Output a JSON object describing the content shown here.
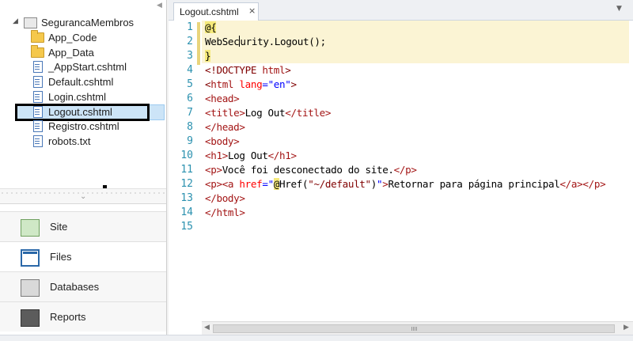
{
  "tree": {
    "root": "SegurancaMembros",
    "items": [
      {
        "label": "App_Code",
        "kind": "folder"
      },
      {
        "label": "App_Data",
        "kind": "folder"
      },
      {
        "label": "_AppStart.cshtml",
        "kind": "file"
      },
      {
        "label": "Default.cshtml",
        "kind": "file"
      },
      {
        "label": "Login.cshtml",
        "kind": "file"
      },
      {
        "label": "Logout.cshtml",
        "kind": "file",
        "selected": true
      },
      {
        "label": "Registro.cshtml",
        "kind": "file"
      },
      {
        "label": "robots.txt",
        "kind": "file"
      }
    ]
  },
  "workspaces": [
    {
      "label": "Site",
      "icon": "site-icon"
    },
    {
      "label": "Files",
      "icon": "files-icon",
      "active": true
    },
    {
      "label": "Databases",
      "icon": "databases-icon"
    },
    {
      "label": "Reports",
      "icon": "reports-icon"
    }
  ],
  "editor": {
    "tab_label": "Logout.cshtml",
    "tab_close": "×",
    "line_numbers": [
      "1",
      "2",
      "3",
      "4",
      "5",
      "6",
      "7",
      "8",
      "9",
      "10",
      "11",
      "12",
      "13",
      "14",
      "15"
    ],
    "lines": {
      "l1": "@{",
      "l2a": "WebSec",
      "l2b": "urity.Logout();",
      "l3": "}",
      "l4a": "<!DOCTYPE ",
      "l4b": "html",
      "l4c": ">",
      "l5a": "<",
      "l5b": "html",
      "l5c": " lang",
      "l5d": "=\"en\"",
      "l5e": ">",
      "l6": "<head>",
      "l7a": "<title>",
      "l7b": "Log Out",
      "l7c": "</title>",
      "l8": "</head>",
      "l9": "<body>",
      "l10a": "<h1>",
      "l10b": "Log Out",
      "l10c": "</h1>",
      "l11a": "<p>",
      "l11b": "Você foi desconectado do site.",
      "l11c": "</p>",
      "l12a": "<p>",
      "l12b": "<a",
      "l12c": " href",
      "l12d": "=\"",
      "l12e": "@",
      "l12f": "Href(",
      "l12g": "\"~/default\"",
      "l12h": ")",
      "l12i": "\"",
      "l12j": ">",
      "l12k": "Retornar para página principal",
      "l12l": "</a>",
      "l12m": "</p>",
      "l13": "</body>",
      "l14": "</html>"
    }
  },
  "colors": {
    "line_number": "#2b91af",
    "tag": "#a31515",
    "attribute": "#ff0000",
    "string": "#0000ff",
    "razor_highlight": "#fbf4d4"
  }
}
